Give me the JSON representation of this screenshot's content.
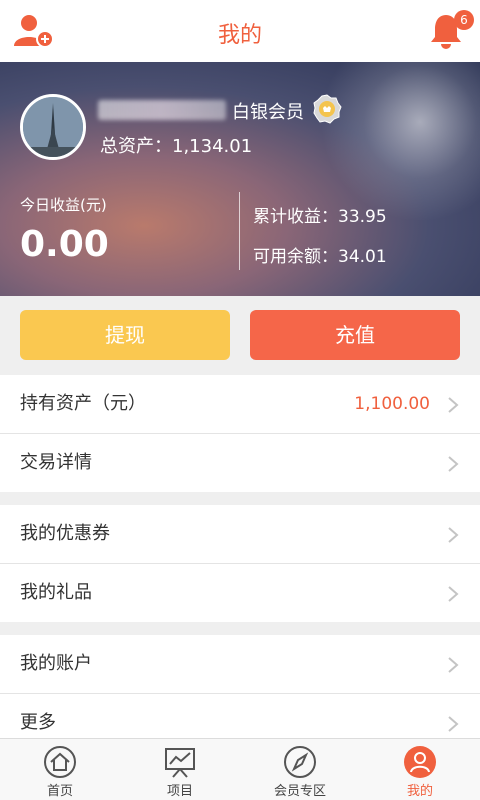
{
  "header": {
    "title": "我的",
    "notification_count": "6"
  },
  "profile": {
    "member_level": "白银会员",
    "total_assets_label": "总资产：",
    "total_assets_value": "1,134.01",
    "today_earnings_label": "今日收益(元)",
    "today_earnings_value": "0.00",
    "cumulative_earnings_label": "累计收益：",
    "cumulative_earnings_value": "33.95",
    "available_balance_label": "可用余额：",
    "available_balance_value": "34.01"
  },
  "actions": {
    "withdraw_label": "提现",
    "recharge_label": "充值"
  },
  "menu": {
    "holdings_label": "持有资产（元）",
    "holdings_value": "1,100.00",
    "transactions_label": "交易详情",
    "coupons_label": "我的优惠券",
    "gifts_label": "我的礼品",
    "account_label": "我的账户",
    "more_label": "更多"
  },
  "tabs": {
    "home": "首页",
    "projects": "项目",
    "vip_zone": "会员专区",
    "mine": "我的"
  },
  "colors": {
    "accent": "#f0603e",
    "withdraw_button": "#fac850",
    "recharge_button": "#f56649"
  }
}
